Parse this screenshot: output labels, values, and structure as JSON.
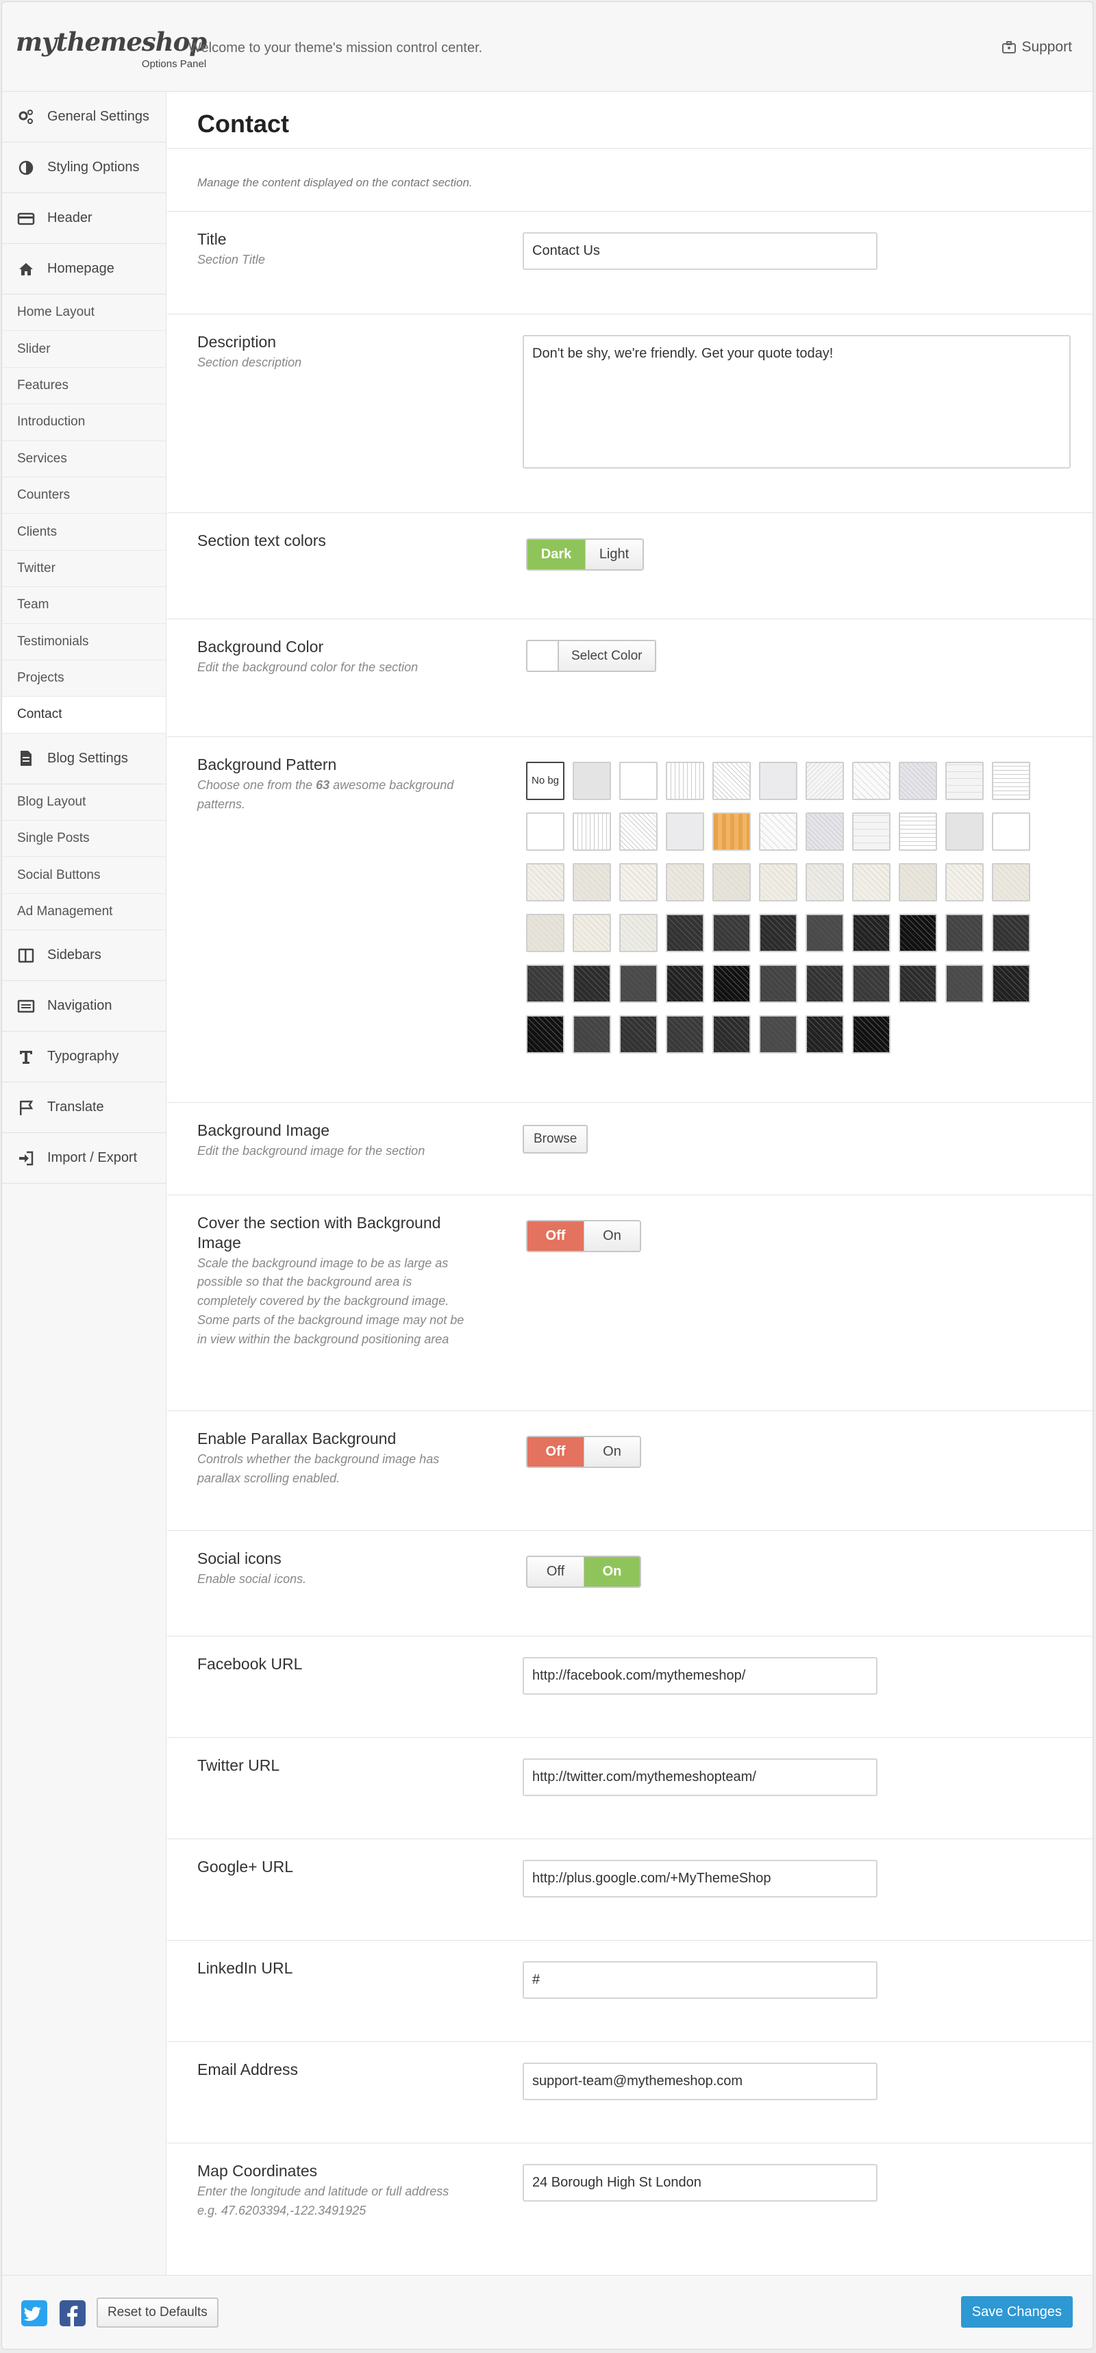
{
  "header": {
    "logo": "mythemeshop",
    "logo_sub": "Options Panel",
    "tagline": "Welcome to your theme's mission control center.",
    "support": "Support"
  },
  "sidebar": {
    "general": "General Settings",
    "styling": "Styling Options",
    "header": "Header",
    "homepage": "Homepage",
    "homepage_items": [
      "Home Layout",
      "Slider",
      "Features",
      "Introduction",
      "Services",
      "Counters",
      "Clients",
      "Twitter",
      "Team",
      "Testimonials",
      "Projects",
      "Contact"
    ],
    "blog": "Blog Settings",
    "blog_items": [
      "Blog Layout",
      "Single Posts",
      "Social Buttons",
      "Ad Management"
    ],
    "sidebars": "Sidebars",
    "navigation": "Navigation",
    "typography": "Typography",
    "translate": "Translate",
    "import_export": "Import / Export"
  },
  "main": {
    "title": "Contact",
    "intro": "Manage the content displayed on the contact section.",
    "title_field": {
      "label": "Title",
      "desc": "Section Title",
      "value": "Contact Us"
    },
    "description_field": {
      "label": "Description",
      "desc": "Section description",
      "value": "Don't be shy, we're friendly. Get your quote today!"
    },
    "text_colors": {
      "label": "Section text colors",
      "dark": "Dark",
      "light": "Light",
      "selected": "Dark"
    },
    "bg_color": {
      "label": "Background Color",
      "desc": "Edit the background color for the section",
      "button": "Select Color",
      "value": "#ffffff"
    },
    "bg_pattern": {
      "label": "Background Pattern",
      "desc_pre": "Choose one from the ",
      "count": "63",
      "desc_post": " awesome background patterns.",
      "nobg": "No bg"
    },
    "bg_image": {
      "label": "Background Image",
      "desc": "Edit the background image for the section",
      "button": "Browse"
    },
    "cover": {
      "label": "Cover the section with Background Image",
      "desc": "Scale the background image to be as large as possible so that the background area is completely covered by the background image. Some parts of the background image may not be in view within the background positioning area",
      "off": "Off",
      "on": "On",
      "selected": "Off"
    },
    "parallax": {
      "label": "Enable Parallax Background",
      "desc": "Controls whether the background image has parallax scrolling enabled.",
      "off": "Off",
      "on": "On",
      "selected": "Off"
    },
    "social": {
      "label": "Social icons",
      "desc": "Enable social icons.",
      "off": "Off",
      "on": "On",
      "selected": "On"
    },
    "facebook": {
      "label": "Facebook URL",
      "value": "http://facebook.com/mythemeshop/"
    },
    "twitter": {
      "label": "Twitter URL",
      "value": "http://twitter.com/mythemeshopteam/"
    },
    "google": {
      "label": "Google+ URL",
      "value": "http://plus.google.com/+MyThemeShop"
    },
    "linkedin": {
      "label": "LinkedIn URL",
      "value": "#"
    },
    "email": {
      "label": "Email Address",
      "value": "support-team@mythemeshop.com"
    },
    "map": {
      "label": "Map Coordinates",
      "desc": "Enter the longitude and latitude or full address e.g. 47.6203394,-122.3491925",
      "value": "24 Borough High St London"
    }
  },
  "footer": {
    "reset": "Reset to Defaults",
    "save": "Save Changes"
  },
  "colors": {
    "accent": "#2e98d3",
    "on_green": "#8fc45a",
    "off_red": "#e3725e",
    "twitter": "#2aa3ef",
    "facebook": "#3b5998"
  }
}
